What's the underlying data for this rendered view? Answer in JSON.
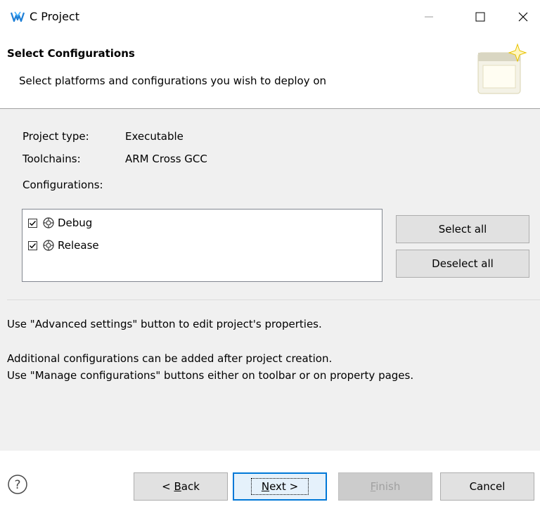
{
  "window": {
    "title": "C Project",
    "icons": [
      "app-logo-icon",
      "minimize-icon",
      "maximize-icon",
      "close-icon"
    ]
  },
  "header": {
    "title": "Select Configurations",
    "description": "Select platforms and configurations you wish to deploy on"
  },
  "info": {
    "project_type_label": "Project type:",
    "project_type_value": "Executable",
    "toolchains_label": "Toolchains:",
    "toolchains_value": "ARM Cross GCC",
    "configurations_label": "Configurations:"
  },
  "configurations": [
    {
      "label": "Debug",
      "checked": true,
      "icon": "gear-icon"
    },
    {
      "label": "Release",
      "checked": true,
      "icon": "gear-icon"
    }
  ],
  "buttons": {
    "select_all": "Select all",
    "deselect_all": "Deselect all"
  },
  "messages": {
    "advanced": "Use \"Advanced settings\" button to edit project's properties.",
    "additional": "Additional configurations can be added after project creation.",
    "manage": "Use \"Manage configurations\" buttons either on toolbar or on property pages."
  },
  "footer": {
    "help_icon": "help-icon",
    "back_prefix": "< ",
    "back_mnemonic": "B",
    "back_rest": "ack",
    "next_mnemonic": "N",
    "next_rest": "ext >",
    "finish_mnemonic": "F",
    "finish_rest": "inish",
    "cancel": "Cancel",
    "finish_enabled": false
  },
  "colors": {
    "content_bg": "#f0f0f0",
    "button_bg": "#e1e1e1",
    "default_button_border": "#0078d7",
    "logo_blue": "#1e7fd6"
  }
}
